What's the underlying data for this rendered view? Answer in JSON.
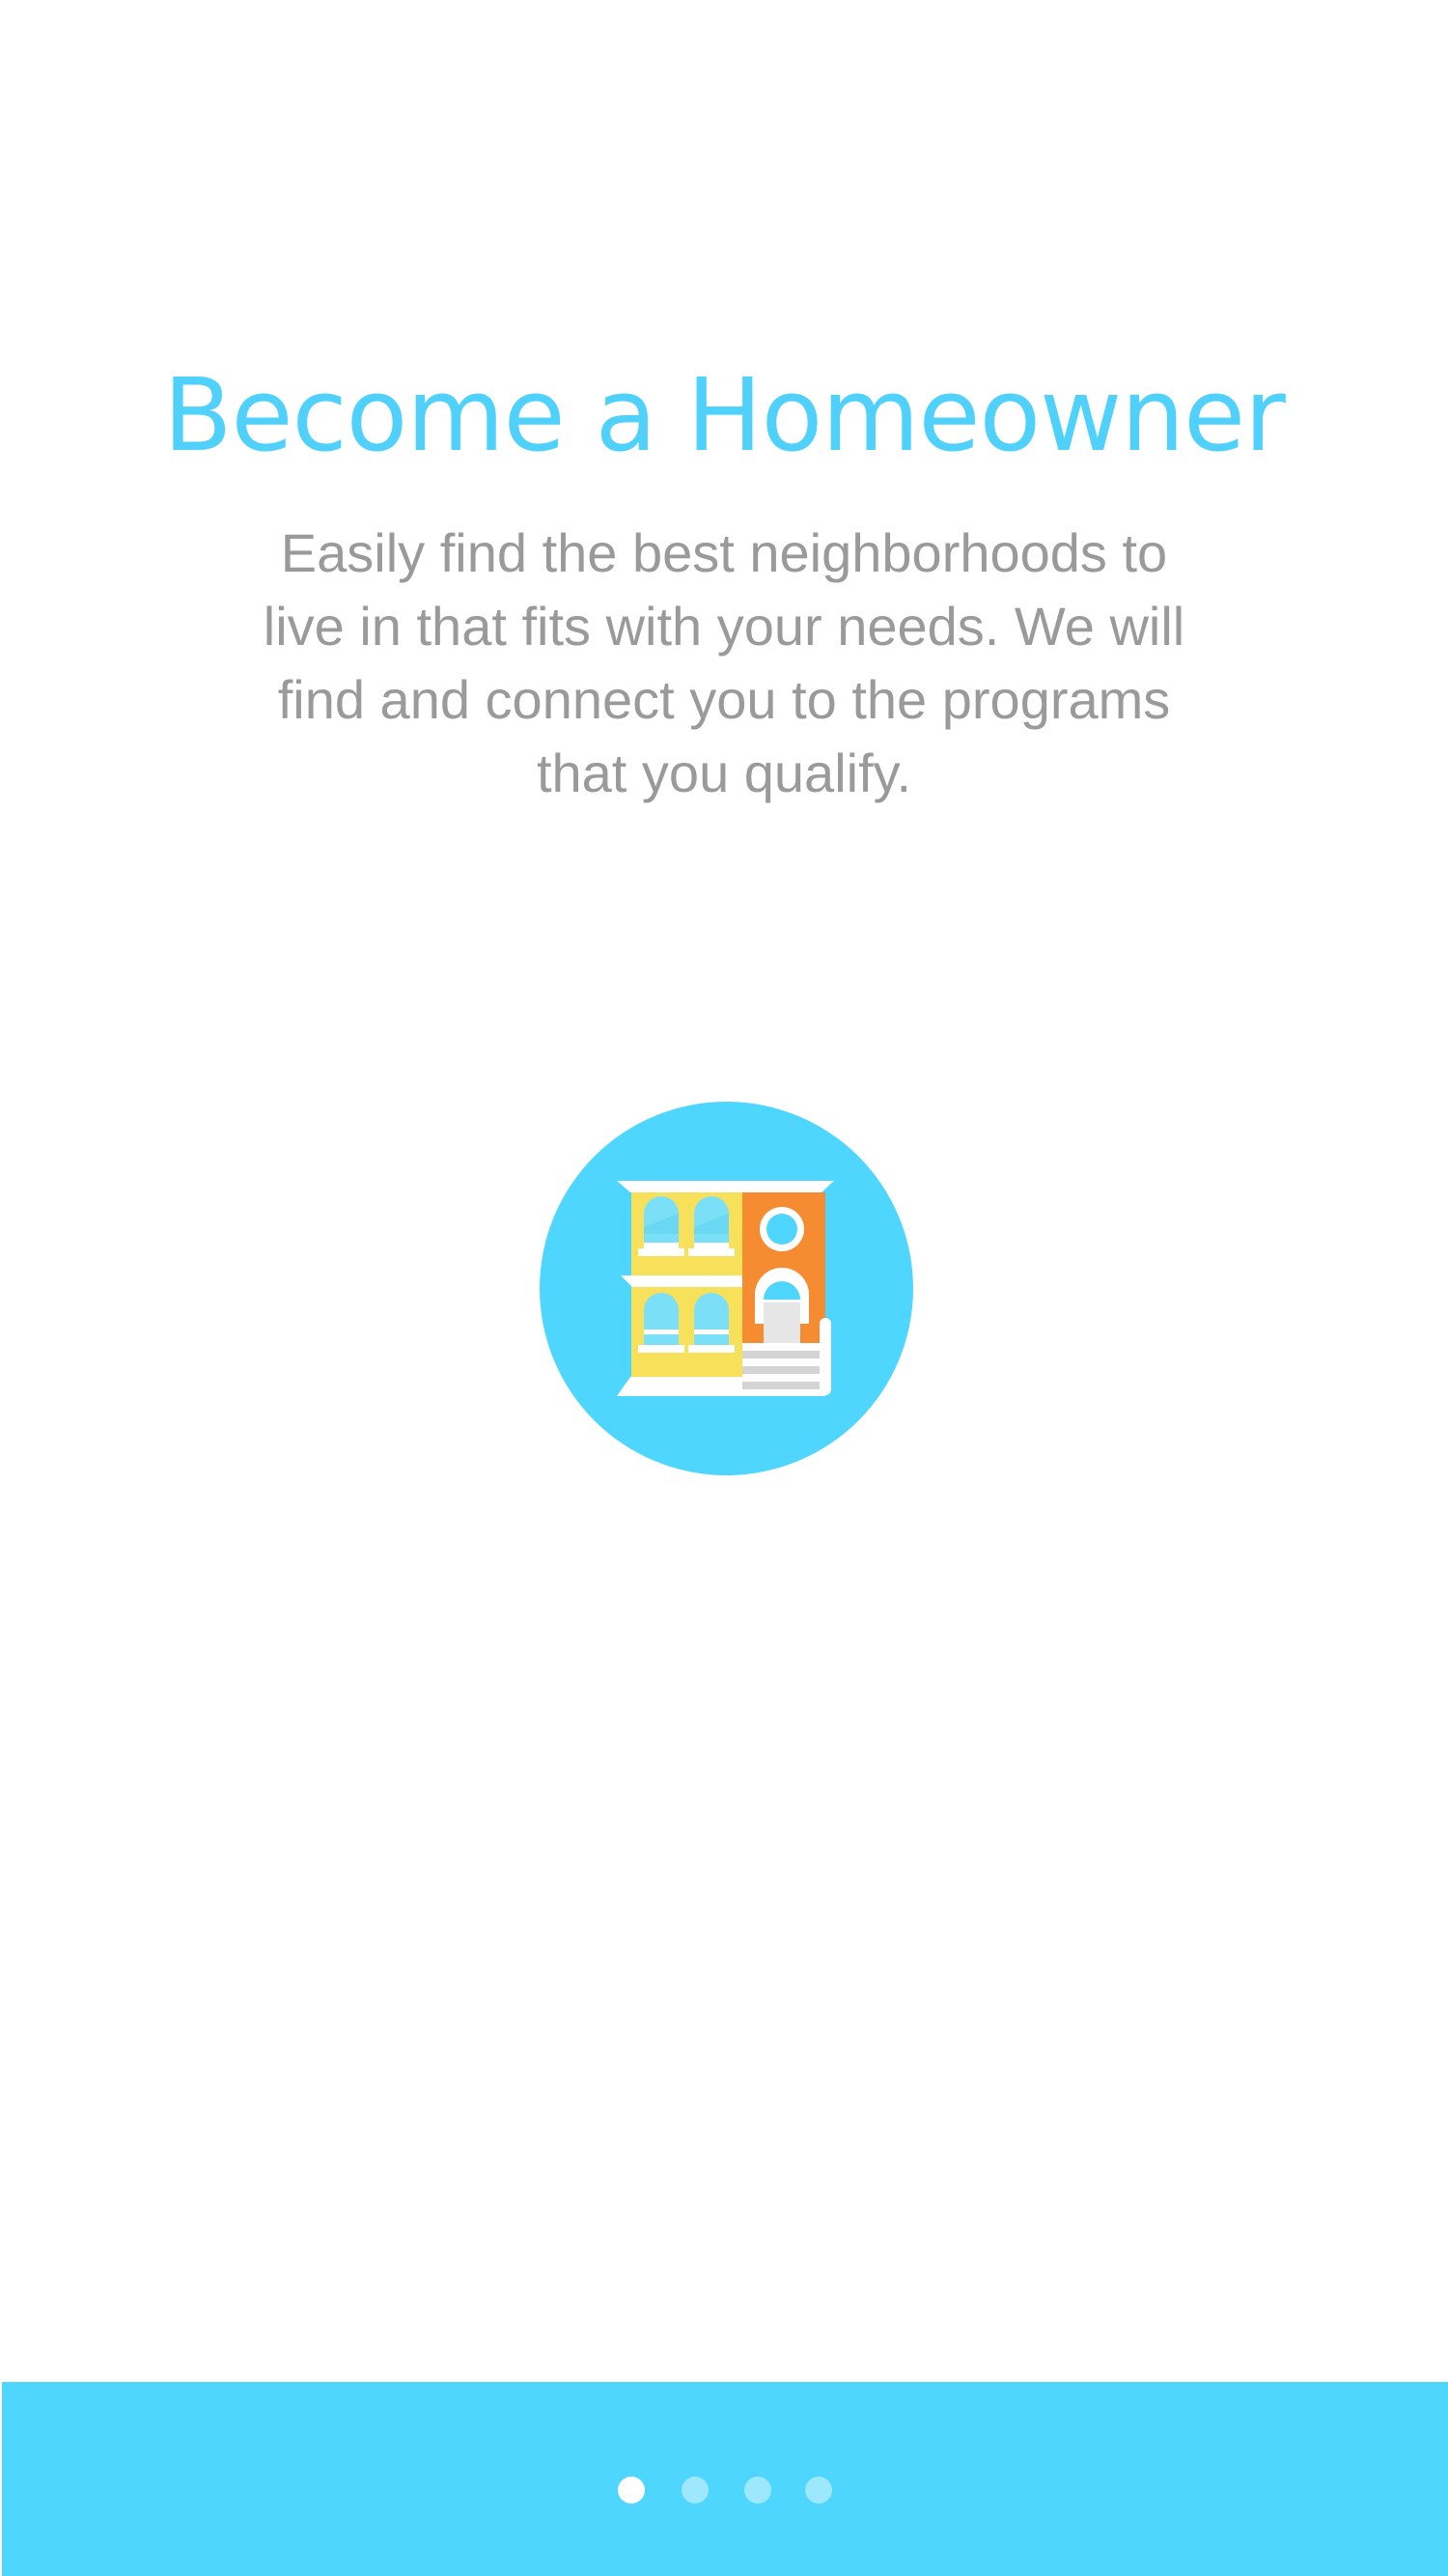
{
  "onboarding": {
    "title": "Become a Homeowner",
    "description": "Easily find the best neighborhoods to live in that fits with your needs. We will find and connect you to the programs that you qualify.",
    "illustration_icon": "townhouse-icon",
    "current_page": 1,
    "total_pages": 4
  },
  "colors": {
    "accent": "#4fd1fb",
    "footer": "#4fd6ff",
    "body_text": "#9a9a9a",
    "house_yellow": "#f7e05a",
    "house_orange": "#f68c32",
    "window_blue": "#7be0f7"
  }
}
